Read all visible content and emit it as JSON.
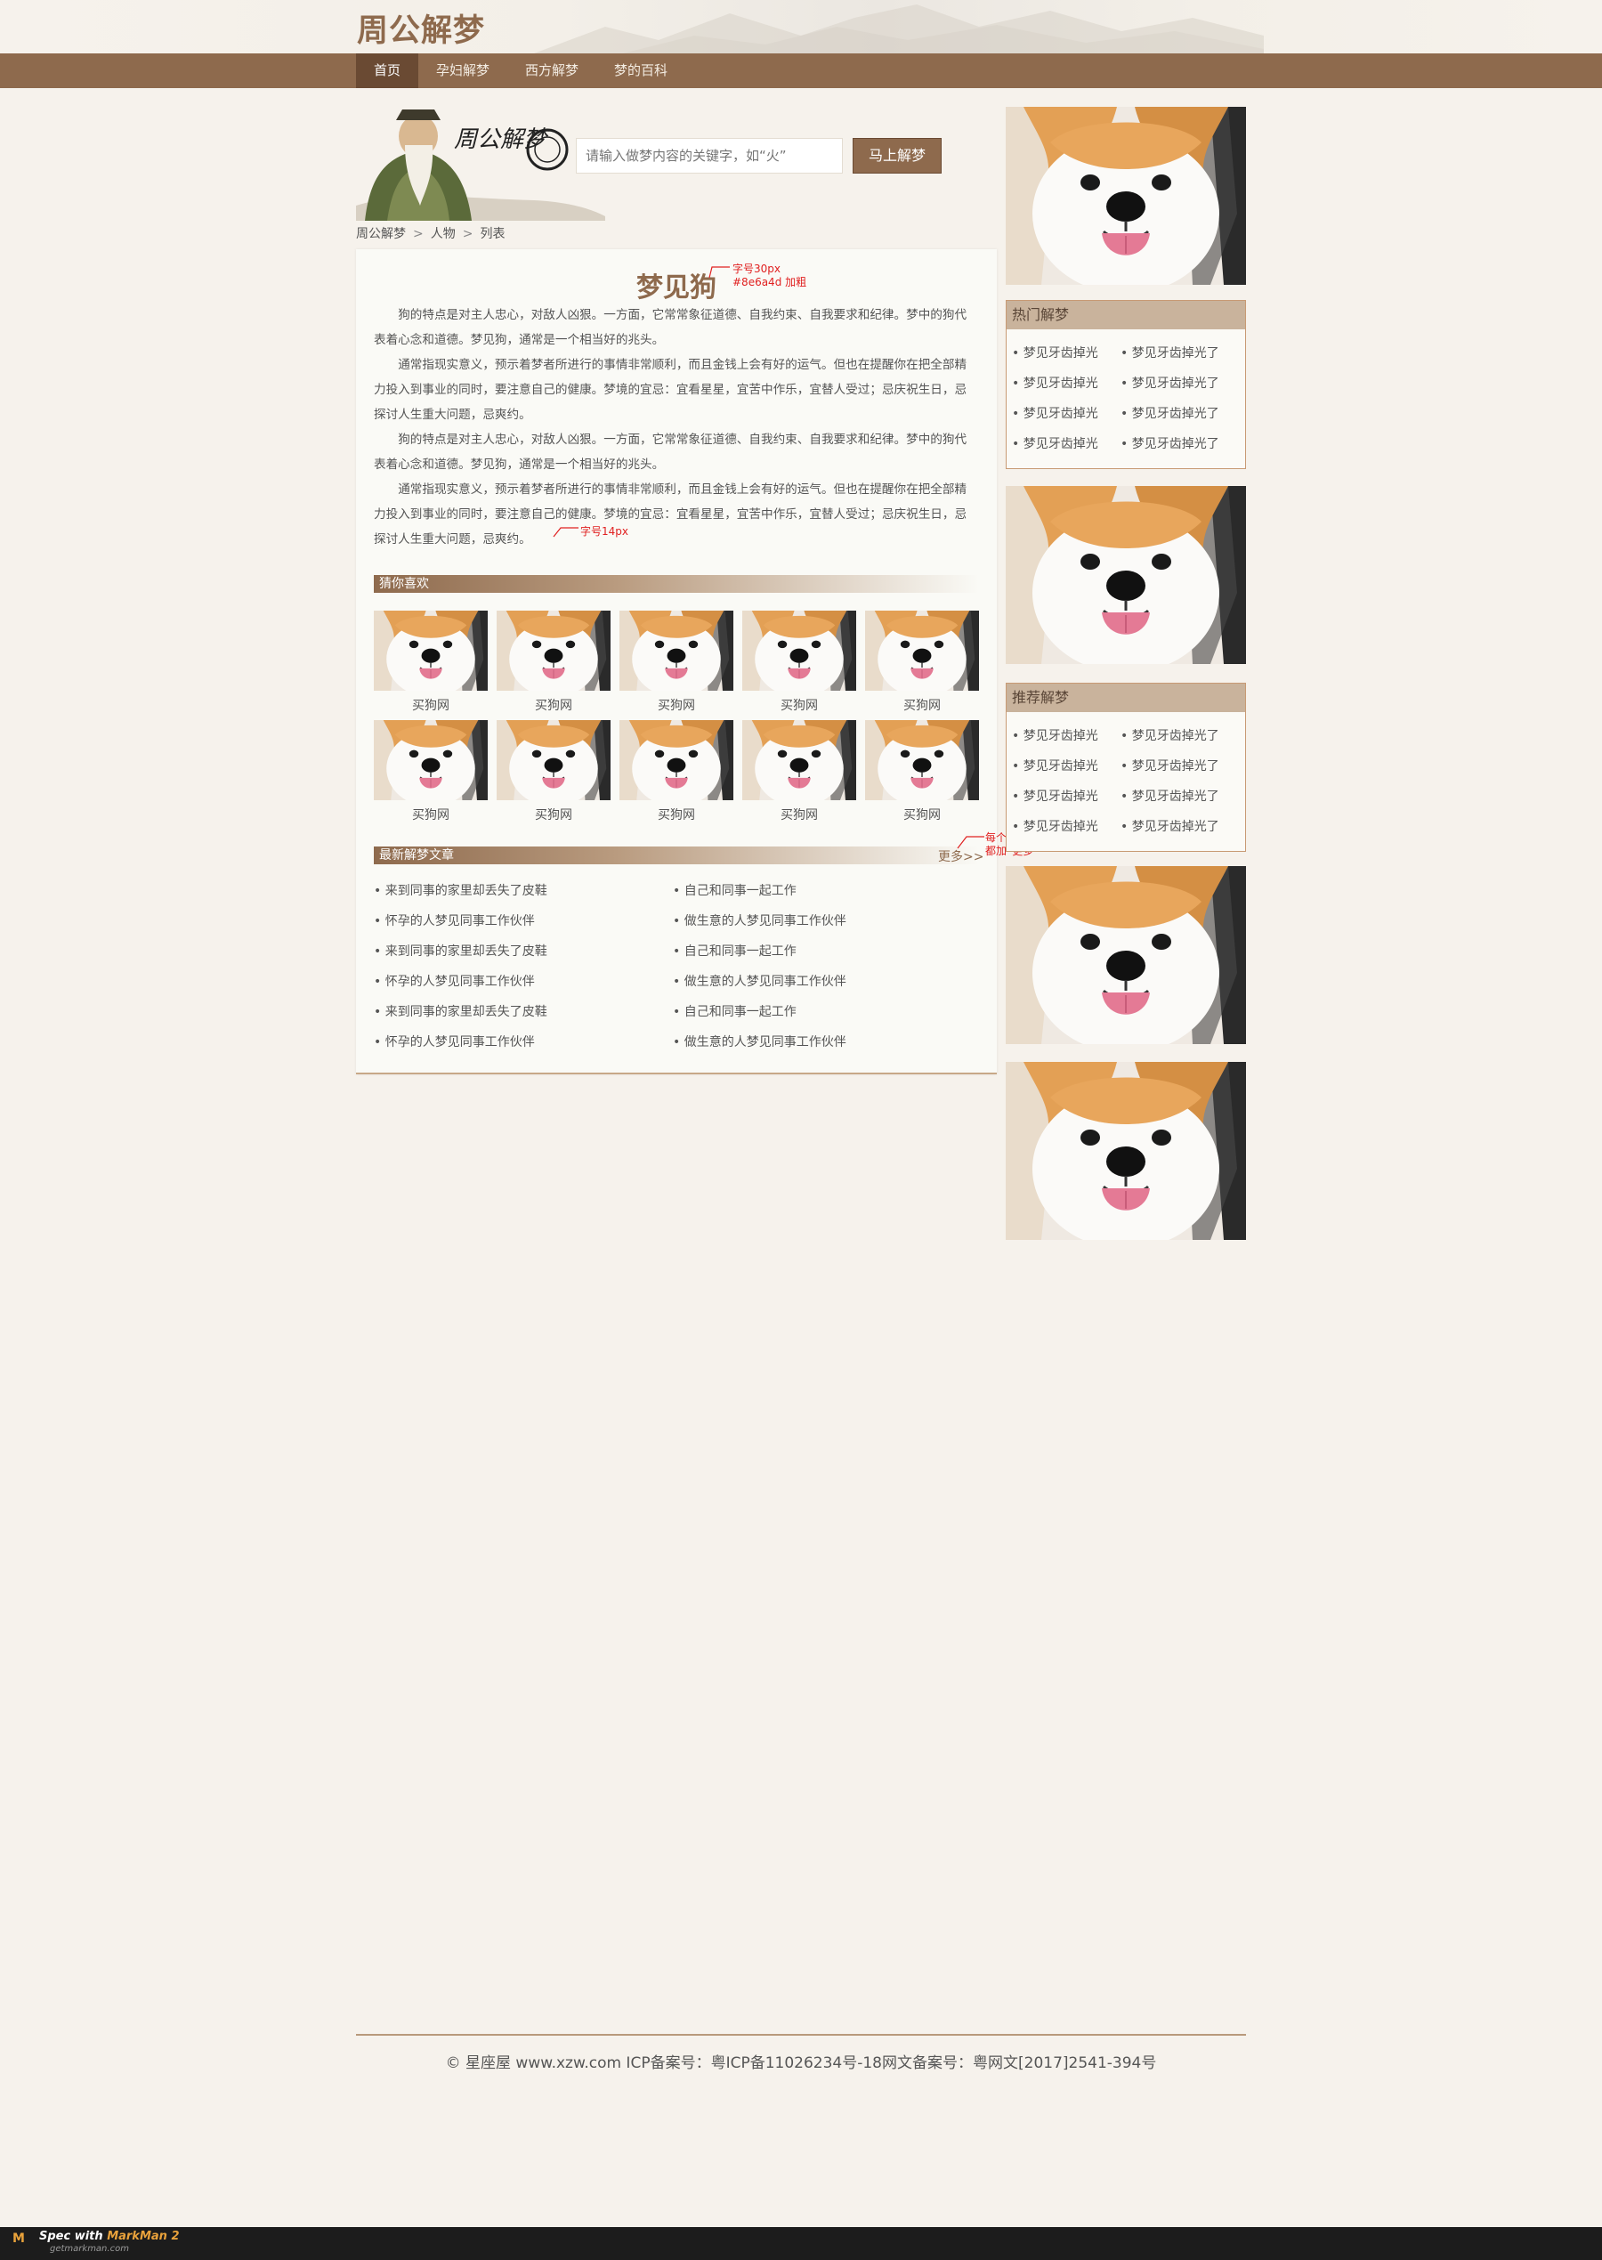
{
  "header": {
    "logo": "周公解梦"
  },
  "nav": {
    "items": [
      "首页",
      "孕妇解梦",
      "西方解梦",
      "梦的百科"
    ],
    "active": 0
  },
  "search": {
    "placeholder": "请输入做梦内容的关键字，如“火”",
    "button": "马上解梦",
    "brand_calligraphy": "周公解梦"
  },
  "breadcrumb": [
    "周公解梦",
    "人物",
    "列表"
  ],
  "article": {
    "title": "梦见狗",
    "paragraphs": [
      "狗的特点是对主人忠心，对敌人凶狠。一方面，它常常象征道德、自我约束、自我要求和纪律。梦中的狗代表着心念和道德。梦见狗，通常是一个相当好的兆头。",
      "通常指现实意义，预示着梦者所进行的事情非常顺利，而且金钱上会有好的运气。但也在提醒你在把全部精力投入到事业的同时，要注意自己的健康。梦境的宜忌：宜看星星，宜苦中作乐，宜替人受过；忌庆祝生日，忌探讨人生重大问题，忌爽约。",
      "狗的特点是对主人忠心，对敌人凶狠。一方面，它常常象征道德、自我约束、自我要求和纪律。梦中的狗代表着心念和道德。梦见狗，通常是一个相当好的兆头。",
      "通常指现实意义，预示着梦者所进行的事情非常顺利，而且金钱上会有好的运气。但也在提醒你在把全部精力投入到事业的同时，要注意自己的健康。梦境的宜忌：宜看星星，宜苦中作乐，宜替人受过；忌庆祝生日，忌探讨人生重大问题，忌爽约。"
    ]
  },
  "guess": {
    "title": "猜你喜欢",
    "captions": [
      "买狗网",
      "买狗网",
      "买狗网",
      "买狗网",
      "买狗网",
      "买狗网",
      "买狗网",
      "买狗网",
      "买狗网",
      "买狗网"
    ]
  },
  "latest": {
    "title": "最新解梦文章",
    "more": "更多>>",
    "left": [
      "来到同事的家里却丢失了皮鞋",
      "怀孕的人梦见同事工作伙伴",
      "来到同事的家里却丢失了皮鞋",
      "怀孕的人梦见同事工作伙伴",
      "来到同事的家里却丢失了皮鞋",
      "怀孕的人梦见同事工作伙伴"
    ],
    "right": [
      "自己和同事一起工作",
      "做生意的人梦见同事工作伙伴",
      "自己和同事一起工作",
      "做生意的人梦见同事工作伙伴",
      "自己和同事一起工作",
      "做生意的人梦见同事工作伙伴"
    ]
  },
  "sidebar": {
    "hot": {
      "title": "热门解梦",
      "left": [
        "梦见牙齿掉光",
        "梦见牙齿掉光",
        "梦见牙齿掉光",
        "梦见牙齿掉光"
      ],
      "right": [
        "梦见牙齿掉光了",
        "梦见牙齿掉光了",
        "梦见牙齿掉光了",
        "梦见牙齿掉光了"
      ]
    },
    "rec": {
      "title": "推荐解梦",
      "left": [
        "梦见牙齿掉光",
        "梦见牙齿掉光",
        "梦见牙齿掉光",
        "梦见牙齿掉光"
      ],
      "right": [
        "梦见牙齿掉光了",
        "梦见牙齿掉光了",
        "梦见牙齿掉光了",
        "梦见牙齿掉光了"
      ]
    }
  },
  "footer": {
    "text": "© 星座屋 www.xzw.com ICP备案号：粤ICP备11026234号-18网文备案号：粤网文[2017]2541-394号"
  },
  "markman": {
    "logo": "M",
    "label": "Spec with",
    "brand": "MarkMan 2",
    "site": "getmarkman.com"
  },
  "annotations": {
    "title_note1": "字号30px",
    "title_note2": "#8e6a4d 加粗",
    "body_note": "字号14px",
    "more_note1": "每个版块栏目下",
    "more_note2": "都加“更多”"
  },
  "colors": {
    "brand": "#8e6a4d",
    "nav_active": "#6a4a33",
    "page_bg": "#f6f2ec",
    "box_header": "#c9b39c",
    "annotation": "#e02020"
  },
  "icons": {
    "dog_photo": "shiba-dog-photo",
    "sage": "sage-portrait"
  }
}
